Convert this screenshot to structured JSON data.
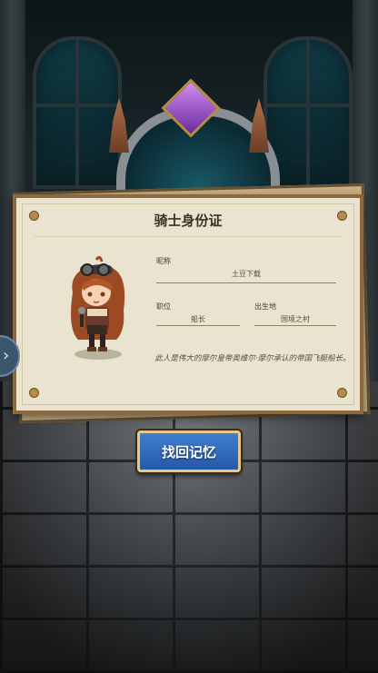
{
  "card": {
    "title": "骑士身份证",
    "nickname_label": "昵称",
    "nickname_value": "土豆下载",
    "position_label": "职位",
    "position_value": "船长",
    "birthplace_label": "出生地",
    "birthplace_value": "国境之村",
    "description": "此人是伟大的摩尔皇帝奥维尔·摩尔承认的帝国飞艇船长。"
  },
  "button": {
    "recall_label": "找回记忆"
  },
  "side_tab": {
    "arrow": "›"
  },
  "colors": {
    "button_blue": "#2f6bc0",
    "card_paper": "#e9e3cf",
    "gem_purple": "#8a3fc2"
  }
}
